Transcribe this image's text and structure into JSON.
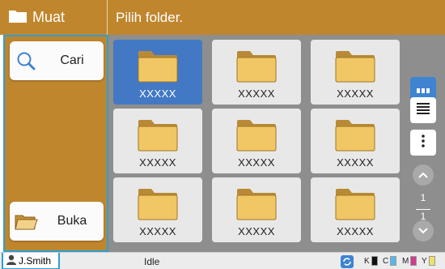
{
  "header": {
    "app_title": "Muat",
    "subtitle": "Pilih folder."
  },
  "sidebar": {
    "search_label": "Cari",
    "open_label": "Buka"
  },
  "folders": [
    {
      "name": "XXXXX",
      "selected": true
    },
    {
      "name": "XXXXX",
      "selected": false
    },
    {
      "name": "XXXXX",
      "selected": false
    },
    {
      "name": "XXXXX",
      "selected": false
    },
    {
      "name": "XXXXX",
      "selected": false
    },
    {
      "name": "XXXXX",
      "selected": false
    },
    {
      "name": "XXXXX",
      "selected": false
    },
    {
      "name": "XXXXX",
      "selected": false
    },
    {
      "name": "XXXXX",
      "selected": false
    }
  ],
  "view": {
    "grid_icon": "grid-view-icon",
    "list_icon": "list-view-icon",
    "more_icon": "more-vertical-icon"
  },
  "pagination": {
    "current": "1",
    "total": "1"
  },
  "status": {
    "user": "J.Smith",
    "state": "Idle",
    "ink_labels": [
      "K",
      "C",
      "M",
      "Y"
    ],
    "ink_colors": [
      "#111111",
      "#58b9e8",
      "#cf3c8b",
      "#f1e06b"
    ],
    "ink_levels": [
      1.0,
      1.0,
      1.0,
      1.0
    ]
  },
  "colors": {
    "brand": "#c0862e",
    "accent": "#3f83d1",
    "selection_border": "#2e9ed6"
  }
}
